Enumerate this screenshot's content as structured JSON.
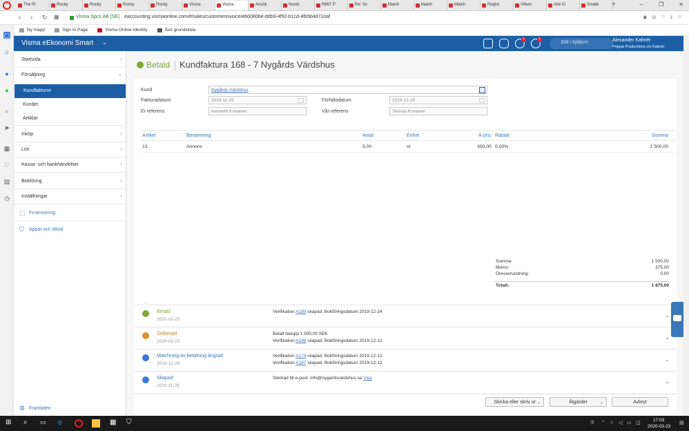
{
  "browser": {
    "tabs": [
      "The Pi",
      "Rocky",
      "Rocky",
      "Rocky",
      "Rocky",
      "Visma",
      "Visma",
      "Ansök",
      "Nordc",
      "R867 P",
      "Re: Sv",
      "Match",
      "Match",
      "Match",
      "Regist",
      "Vilken",
      "Alla Vi",
      "Snabb"
    ],
    "new_tab": "+",
    "secure_label": "Visma Spcs AB [SE]",
    "url": "eaccounting.vismaonline.com/#/sales/customerinvoice/eb0080be-ddb9-4f92-b1cd-4fb5b4d710af",
    "bookmarks": [
      "Ny mapp",
      "Sign In Page",
      "Visma Online Identity",
      "Åsö grundskola"
    ]
  },
  "header": {
    "brand": "Visma eEkonomi Smart",
    "search_placeholder": "Sök i hjälpen",
    "user_name": "Alexander Kalmér",
    "user_company": "Pripyat Productions c/o Kalmér",
    "badge_alerts": "1",
    "badge_help": "1"
  },
  "sidebar": {
    "items": [
      {
        "label": "Startsida"
      },
      {
        "label": "Försäljning"
      },
      {
        "label": "Inköp"
      },
      {
        "label": "Lön"
      },
      {
        "label": "Kassa- och bankhändelser"
      },
      {
        "label": "Bokföring"
      },
      {
        "label": "Inställningar"
      }
    ],
    "sub": [
      "Kundfakturor",
      "Kunder",
      "Artiklar"
    ],
    "links": [
      "Finansiering",
      "Appar och tillval"
    ],
    "footer_link": "Framtiden"
  },
  "invoice": {
    "status": "Betald",
    "title": "Kundfaktura 168 - 7 Nygårds Värdshus",
    "kund_label": "Kund",
    "kund_value": "Nygårds Värdshus",
    "fakturadatum_label": "Fakturadatum",
    "fakturadatum_value": "2019-11-25",
    "forfallodatum_label": "Förfallodatum",
    "forfallodatum_value": "2019-12-25",
    "er_referens_label": "Er referens",
    "er_referens_value": "Kenneth Kovanen",
    "var_referens_label": "Vår referens",
    "var_referens_value": "Teresia Kovanen"
  },
  "table": {
    "headers": [
      "Artikel",
      "Benämning",
      "Antal",
      "Enhet",
      "À-pris",
      "Rabatt",
      "Summa"
    ],
    "rows": [
      [
        "13",
        "Annons",
        "5,00",
        "st",
        "300,00",
        "0,00%",
        "1 500,00"
      ]
    ]
  },
  "totals": {
    "summa_label": "Summa:",
    "summa": "1 500,00",
    "moms_label": "Moms:",
    "moms": "375,00",
    "ores_label": "Öresavrundning:",
    "ores": "0,00",
    "totalt_label": "Totalt:",
    "totalt": "1 875,00"
  },
  "timeline": [
    {
      "name": "Betald",
      "date": "2020-03-23",
      "color": "#7ea832",
      "name_color": "#7ea832",
      "l1a": "Verifikation ",
      "l1link": "A189",
      "l1b": " skapad, Bokföringsdatum 2019-12-24",
      "l2a": "",
      "l2link": "",
      "l2b": ""
    },
    {
      "name": "Delbetald",
      "date": "2020-03-23",
      "color": "#e0902a",
      "name_color": "#c9852c",
      "l1a": "Betalt belopp 1 500,00 SEK",
      "l1link": "",
      "l1b": "",
      "l2a": "Verifikation ",
      "l2link": "A188",
      "l2b": " skapad, Bokföringsdatum 2019-12-12"
    },
    {
      "name": "Matchning av betalning ångrad",
      "date": "2019-12-28",
      "color": "#3a77d8",
      "name_color": "#3a77b8",
      "l1a": "Verifikation ",
      "l1link": "A174",
      "l1b": " skapad, Bokföringsdatum 2019-12-12",
      "l2a": "Verifikation ",
      "l2link": "A187",
      "l2b": " skapad, Bokföringsdatum 2019-12-12"
    },
    {
      "name": "Skapad",
      "date": "2019-11-29",
      "color": "#3a77d8",
      "name_color": "#3a77b8",
      "l1a": "Skickad till e-post: info@nygardsvardshus.se ",
      "l1link": "Visa",
      "l1b": "",
      "l2a": "",
      "l2link": "",
      "l2b": ""
    }
  ],
  "footer": {
    "send_label": "Skicka eller skriv ut",
    "actions_label": "Åtgärder",
    "cancel_label": "Avbryt"
  },
  "taskbar": {
    "time": "17:03",
    "date": "2020-03-23"
  }
}
